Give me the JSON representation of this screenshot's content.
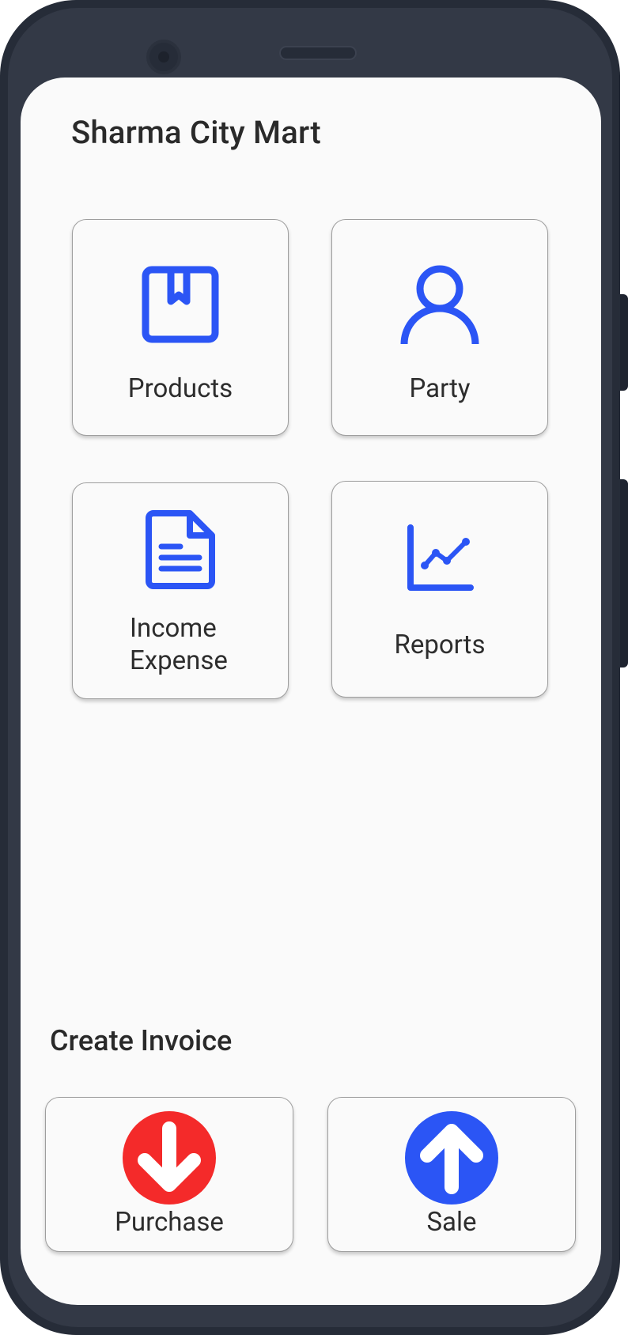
{
  "app": {
    "store_name": "Sharma City Mart"
  },
  "menu": {
    "products_label": "Products",
    "party_label": "Party",
    "income_expense_label": "Income\nExpense",
    "reports_label": "Reports"
  },
  "invoice": {
    "section_title": "Create Invoice",
    "purchase_label": "Purchase",
    "sale_label": "Sale"
  },
  "colors": {
    "icon_blue": "#2b55f5",
    "purchase_red": "#f42a2a",
    "sale_blue": "#2b55f5",
    "screen_bg": "#fafafa",
    "frame": "#262c38"
  },
  "icons": {
    "products": "book-bookmark-icon",
    "party": "person-icon",
    "income_expense": "document-icon",
    "reports": "line-chart-icon",
    "purchase": "arrow-down-circle-icon",
    "sale": "arrow-up-circle-icon"
  }
}
